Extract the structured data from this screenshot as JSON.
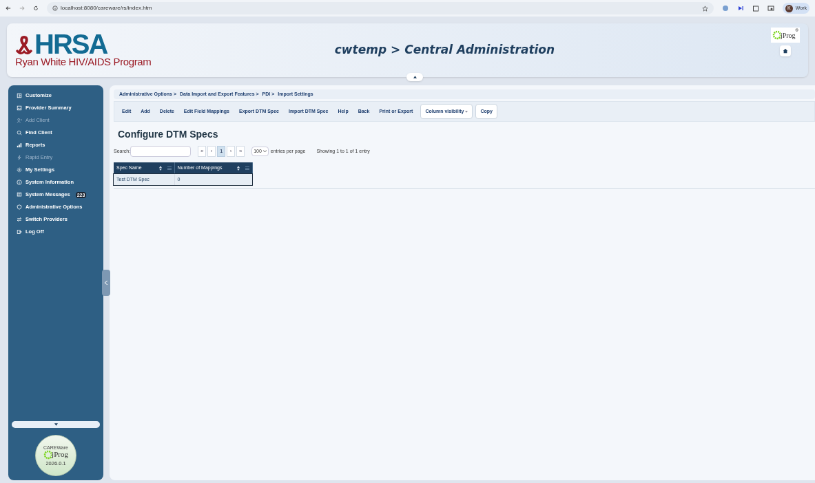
{
  "browser": {
    "url": "localhost:8080/careware/rs/index.htm",
    "profile_initial": "K",
    "profile": "Work"
  },
  "header": {
    "logo": "HRSA",
    "logo_subtitle": "Ryan White HIV/AIDS Program",
    "title": "cwtemp > Central Administration",
    "brand": "jProg",
    "brand_mark": "®"
  },
  "sidebar": {
    "items": [
      {
        "label": "Customize",
        "disabled": false
      },
      {
        "label": "Provider Summary",
        "disabled": false
      },
      {
        "label": "Add Client",
        "disabled": true
      },
      {
        "label": "Find Client",
        "disabled": false
      },
      {
        "label": "Reports",
        "disabled": false
      },
      {
        "label": "Rapid Entry",
        "disabled": true
      },
      {
        "label": "My Settings",
        "disabled": false
      },
      {
        "label": "System Information",
        "disabled": false
      },
      {
        "label": "System Messages",
        "disabled": false,
        "badge": "223"
      },
      {
        "label": "Administrative Options",
        "disabled": false
      },
      {
        "label": "Switch Providers",
        "disabled": false
      },
      {
        "label": "Log Off",
        "disabled": false
      }
    ],
    "badge": {
      "top": "CAREWare",
      "brand": "jProg",
      "version": "2026.0.1"
    }
  },
  "breadcrumb": [
    "Administrative Options >",
    "Data Import and Export Features >",
    "PDI >",
    "Import Settings"
  ],
  "toolbar": [
    {
      "label": "Edit",
      "kind": "link"
    },
    {
      "label": "Add",
      "kind": "link"
    },
    {
      "label": "Delete",
      "kind": "link"
    },
    {
      "label": "Edit Field Mappings",
      "kind": "link"
    },
    {
      "label": "Export DTM Spec",
      "kind": "link"
    },
    {
      "label": "Import DTM Spec",
      "kind": "link"
    },
    {
      "label": "Help",
      "kind": "link"
    },
    {
      "label": "Back",
      "kind": "link"
    },
    {
      "label": "Print or Export",
      "kind": "link"
    },
    {
      "label": "Column visibility",
      "kind": "dropdown"
    },
    {
      "label": "Copy",
      "kind": "button"
    }
  ],
  "page_title": "Configure DTM Specs",
  "search": {
    "label": "Search:"
  },
  "pagination": [
    {
      "label": "«",
      "selected": false
    },
    {
      "label": "‹",
      "selected": false
    },
    {
      "label": "1",
      "selected": true
    },
    {
      "label": "›",
      "selected": false
    },
    {
      "label": "»",
      "selected": false
    }
  ],
  "page_size": {
    "value": "100",
    "label": "entries per page"
  },
  "info": "Showing 1 to 1 of 1 entry",
  "table": {
    "columns": [
      "Spec Name",
      "Number of Mappings"
    ],
    "rows": [
      {
        "cells": [
          "Test DTM Spec",
          "0"
        ],
        "selected": true
      }
    ]
  }
}
